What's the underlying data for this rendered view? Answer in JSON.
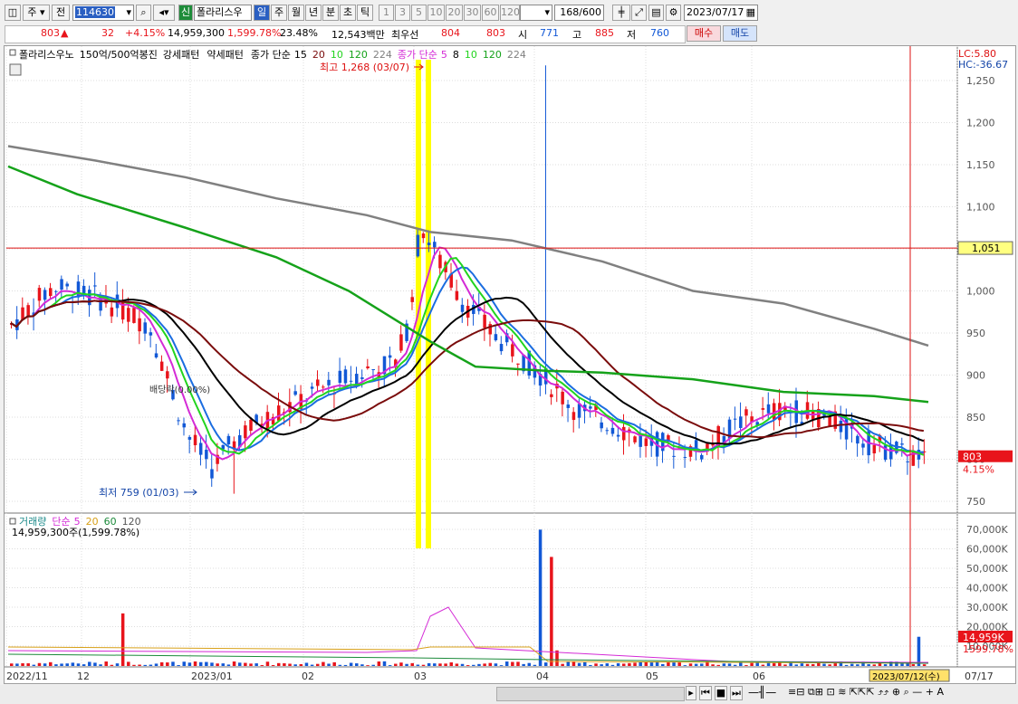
{
  "toolbar": {
    "market_sel": "주",
    "prev_label": "전",
    "code": "114630",
    "new_badge": "신",
    "stock_name": "폴라리스우",
    "periods": [
      "일",
      "주",
      "월",
      "년",
      "분",
      "초",
      "틱"
    ],
    "active_period": "일",
    "intervals": [
      "1",
      "3",
      "5",
      "10",
      "20",
      "30",
      "60",
      "120"
    ],
    "count": "168",
    "count_total": "/600",
    "date": "2023/07/17"
  },
  "quote": {
    "price": "803",
    "change_arrow": "▲",
    "change": "32",
    "change_pct": "+4.15%",
    "volume": "14,959,300",
    "volume_ratio": "1,599.78%",
    "turnover": "23.48%",
    "trade_value": "12,543백만",
    "best_ask_label": "최우선",
    "best_ask": "804",
    "best_bid": "803",
    "open_label": "시",
    "open": "771",
    "high_label": "고",
    "high": "885",
    "low_label": "저",
    "low": "760",
    "buy_label": "매수",
    "sell_label": "매도"
  },
  "legend": {
    "name": "폴라리스우노",
    "pattern1": "150억/500억봉진",
    "pattern2": "강세패턴",
    "pattern3": "약세패턴",
    "ma1_label": "종가 단순",
    "ma1_periods": [
      "15",
      "20",
      "10",
      "120",
      "224"
    ],
    "ma2_label": "종가 단순",
    "ma2_periods": [
      "5",
      "8",
      "10",
      "120",
      "224"
    ],
    "lc": "LC:5.80",
    "hc": "HC:-36.67"
  },
  "annotations": {
    "max_label": "최고 1,268 (03/07)",
    "min_label": "최저 759 (01/03)",
    "mid_label": "배당락(0.00%)",
    "crosshair_price": "1,051",
    "last_price": "803",
    "last_pct": "4.15%"
  },
  "volume_panel": {
    "title": "거래량",
    "ma_label": "단순",
    "ma_periods": [
      "5",
      "20",
      "60",
      "120"
    ],
    "value_text": "14,959,300주(1,599.78%)",
    "last_volume": "14,959K",
    "last_ratio": "1599.78%"
  },
  "colors": {
    "up": "#e8141b",
    "down": "#1258d6",
    "ma5": "#d42ad6",
    "ma10": "#1b6de0",
    "ma15": "#22d41e",
    "ma20": "#000000",
    "ma60": "#7a0c0c",
    "ma120": "#15a21a",
    "ma224": "#808080",
    "highlight": "#ffff00"
  },
  "chart_data": {
    "type": "candlestick",
    "price_axis": [
      "1,250",
      "1,200",
      "1,150",
      "1,100",
      "1,050",
      "1,000",
      "950",
      "900",
      "850",
      "800",
      "750"
    ],
    "volume_axis": [
      "70,000K",
      "60,000K",
      "50,000K",
      "40,000K",
      "30,000K",
      "20,000K",
      "10,000K"
    ],
    "x_labels": [
      "2022/11",
      "12",
      "2023/01",
      "02",
      "03",
      "04",
      "05",
      "06",
      "07/17"
    ],
    "crosshair_date": "2023/07/12(수)"
  }
}
